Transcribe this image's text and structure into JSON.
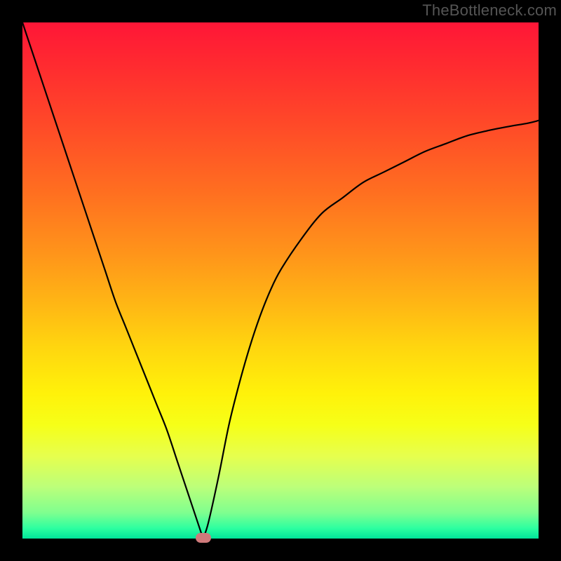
{
  "watermark": "TheBottleneck.com",
  "colors": {
    "page_bg": "#000000",
    "gradient_top": "#ff1637",
    "gradient_mid": "#ffd60f",
    "gradient_bottom": "#00e49a",
    "curve_stroke": "#000000",
    "marker_fill": "#cf7a7b"
  },
  "chart_data": {
    "type": "line",
    "title": "",
    "xlabel": "",
    "ylabel": "",
    "xlim": [
      0,
      100
    ],
    "ylim": [
      0,
      100
    ],
    "grid": false,
    "legend": false,
    "x": [
      0,
      2,
      4,
      6,
      8,
      10,
      12,
      14,
      16,
      18,
      20,
      22,
      24,
      26,
      28,
      30,
      32,
      34,
      35,
      36,
      38,
      40,
      42,
      44,
      46,
      48,
      50,
      54,
      58,
      62,
      66,
      70,
      74,
      78,
      82,
      86,
      90,
      94,
      98,
      100
    ],
    "values": [
      100,
      94,
      88,
      82,
      76,
      70,
      64,
      58,
      52,
      46,
      41,
      36,
      31,
      26,
      21,
      15,
      9,
      3,
      0,
      3,
      12,
      22,
      30,
      37,
      43,
      48,
      52,
      58,
      63,
      66,
      69,
      71,
      73,
      75,
      76.5,
      78,
      79,
      79.8,
      80.5,
      81
    ],
    "marker": {
      "x": 35,
      "y": 0
    },
    "notes": "Percent-space coordinates. Left branch descends near-linearly from (0,100) to cusp at (35,0); right branch rises concavely (decelerating) toward ~(100,81)."
  }
}
